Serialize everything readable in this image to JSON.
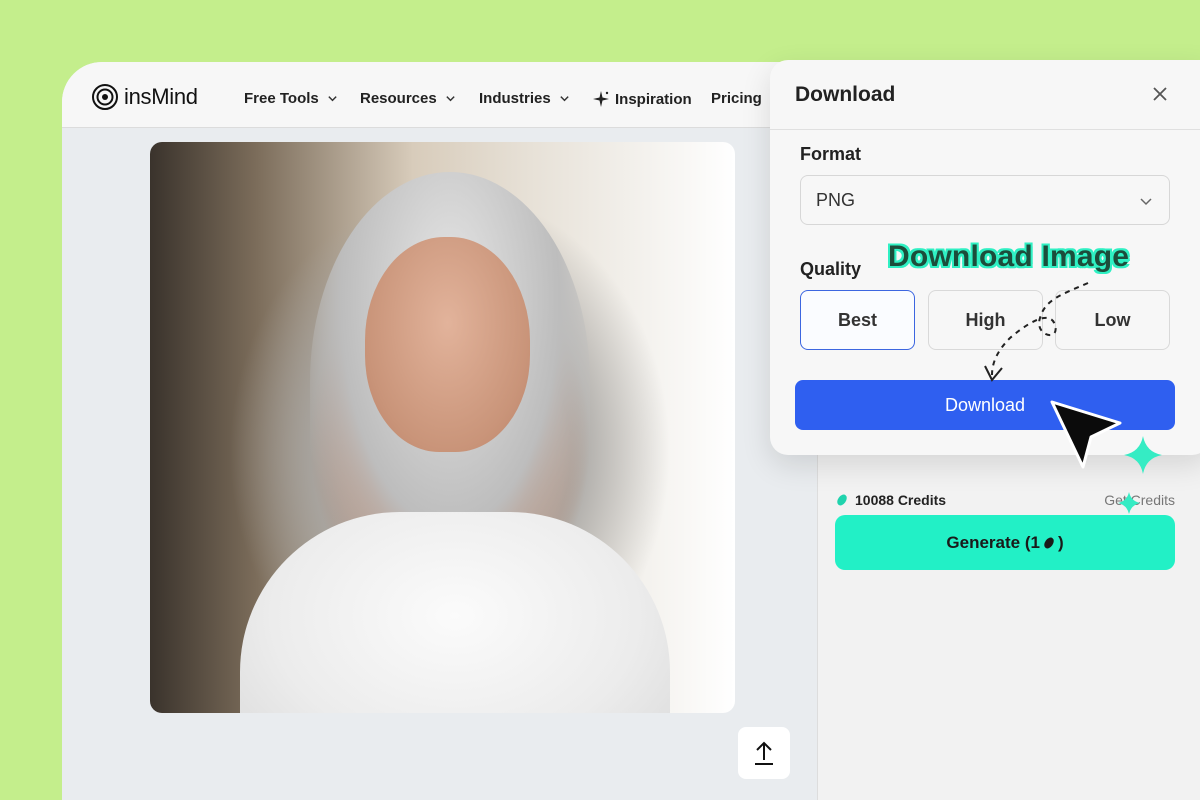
{
  "brand": {
    "name": "insMind"
  },
  "nav": {
    "items": [
      {
        "label": "Free Tools",
        "has_dropdown": true
      },
      {
        "label": "Resources",
        "has_dropdown": true
      },
      {
        "label": "Industries",
        "has_dropdown": true
      },
      {
        "label": "Inspiration",
        "icon": "sparkle-icon"
      },
      {
        "label": "Pricing"
      }
    ]
  },
  "canvas": {
    "image_alt": "Portrait of a smiling woman with long gray hair in a white t-shirt",
    "upload_icon": "upload-arrow-icon"
  },
  "side_panel": {
    "credits_value": "10088 Credits",
    "get_credits_label": "Get Credits",
    "generate_label": "Generate (1",
    "generate_suffix": ")"
  },
  "download_modal": {
    "title": "Download",
    "format_label": "Format",
    "format_value": "PNG",
    "quality_label": "Quality",
    "quality_options": [
      "Best",
      "High",
      "Low"
    ],
    "quality_selected": "Best",
    "download_button": "Download"
  },
  "annotation": {
    "text": "Download Image"
  },
  "colors": {
    "page_bg": "#c4ee8c",
    "accent_blue": "#2f5ff0",
    "accent_teal": "#22f0c6",
    "annotation_text": "#1c4d3b"
  }
}
